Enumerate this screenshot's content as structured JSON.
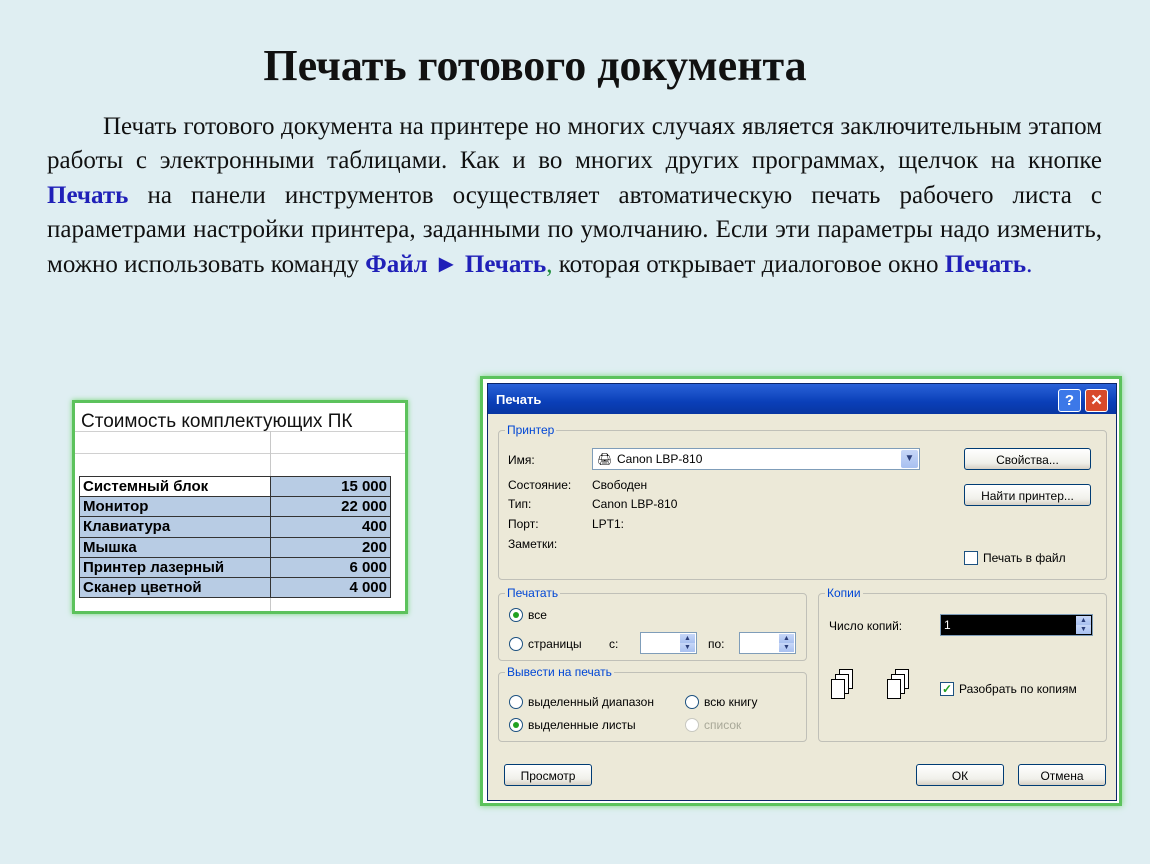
{
  "slide": {
    "title": "Печать готового документа",
    "para": {
      "p1": "Печать готового документа на принтере но многих случаях является заключительным этапом работы с электронными таблицами. Как и во многих других программах, щелчок на кнопке",
      "hl1": "Печать",
      "p2": "на панели инструментов осуществляет автоматическую печать рабочего листа с параметрами настройки принтера, заданными по умолчанию. Если эти параметры надо изменить, можно использовать команду",
      "hl2": "Файл ► Печать",
      "comma": ",",
      "p3": "которая открывает диалоговое окно",
      "hl3": "Печать",
      "dot": "."
    }
  },
  "sheet": {
    "title": "Стоимость комплектующих ПК",
    "rows": [
      {
        "name": "Системный блок",
        "value": "15 000"
      },
      {
        "name": "Монитор",
        "value": "22 000"
      },
      {
        "name": "Клавиатура",
        "value": "400"
      },
      {
        "name": "Мышка",
        "value": "200"
      },
      {
        "name": "Принтер лазерный",
        "value": "6 000"
      },
      {
        "name": "Сканер цветной",
        "value": "4 000"
      }
    ]
  },
  "dialog": {
    "title": "Печать",
    "help_glyph": "?",
    "close_glyph": "✕",
    "printer": {
      "group_label": "Принтер",
      "name_label": "Имя:",
      "name_value": "Canon LBP-810",
      "status_label": "Состояние:",
      "status_value": "Свободен",
      "type_label": "Тип:",
      "type_value": "Canon LBP-810",
      "port_label": "Порт:",
      "port_value": "LPT1:",
      "notes_label": "Заметки:",
      "properties_button": "Свойства...",
      "find_button": "Найти принтер...",
      "print_to_file": "Печать в файл",
      "print_to_file_checked": false
    },
    "range": {
      "group_label": "Печатать",
      "all": "все",
      "all_selected": true,
      "pages": "страницы",
      "from_label": "с:",
      "to_label": "по:"
    },
    "output": {
      "group_label": "Вывести на печать",
      "selection": "выделенный диапазон",
      "whole_book": "всю книгу",
      "active_sheets": "выделенные листы",
      "active_sheets_selected": true,
      "list": "список"
    },
    "copies": {
      "group_label": "Копии",
      "count_label": "Число копий:",
      "count_value": "1",
      "collate": "Разобрать по копиям",
      "collate_checked": true
    },
    "preview_button": "Просмотр",
    "ok_button": "ОК",
    "cancel_button": "Отмена"
  }
}
